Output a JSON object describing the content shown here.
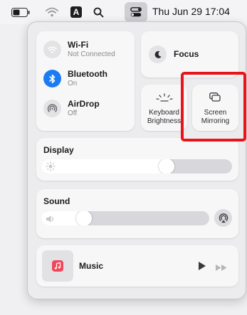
{
  "menubar": {
    "icons": [
      "battery-icon",
      "wifi-icon",
      "input-source-a-icon",
      "spotlight-search-icon",
      "control-center-icon"
    ],
    "input_source_letter": "A",
    "clock": "Thu Jun 29 17:04"
  },
  "control_center": {
    "wifi": {
      "title": "Wi-Fi",
      "status": "Not Connected"
    },
    "bluetooth": {
      "title": "Bluetooth",
      "status": "On"
    },
    "airdrop": {
      "title": "AirDrop",
      "status": "Off"
    },
    "focus": {
      "label": "Focus"
    },
    "keyboard_brightness": {
      "line1": "Keyboard",
      "line2": "Brightness"
    },
    "screen_mirroring": {
      "line1": "Screen",
      "line2": "Mirroring"
    },
    "display": {
      "label": "Display",
      "level_percent": 67
    },
    "sound": {
      "label": "Sound",
      "level_percent": 23
    },
    "music": {
      "label": "Music"
    }
  },
  "colors": {
    "bluetooth_accent": "#1a7cf5",
    "music_icon": "#f2465a",
    "highlight_outline": "#e8141a"
  }
}
